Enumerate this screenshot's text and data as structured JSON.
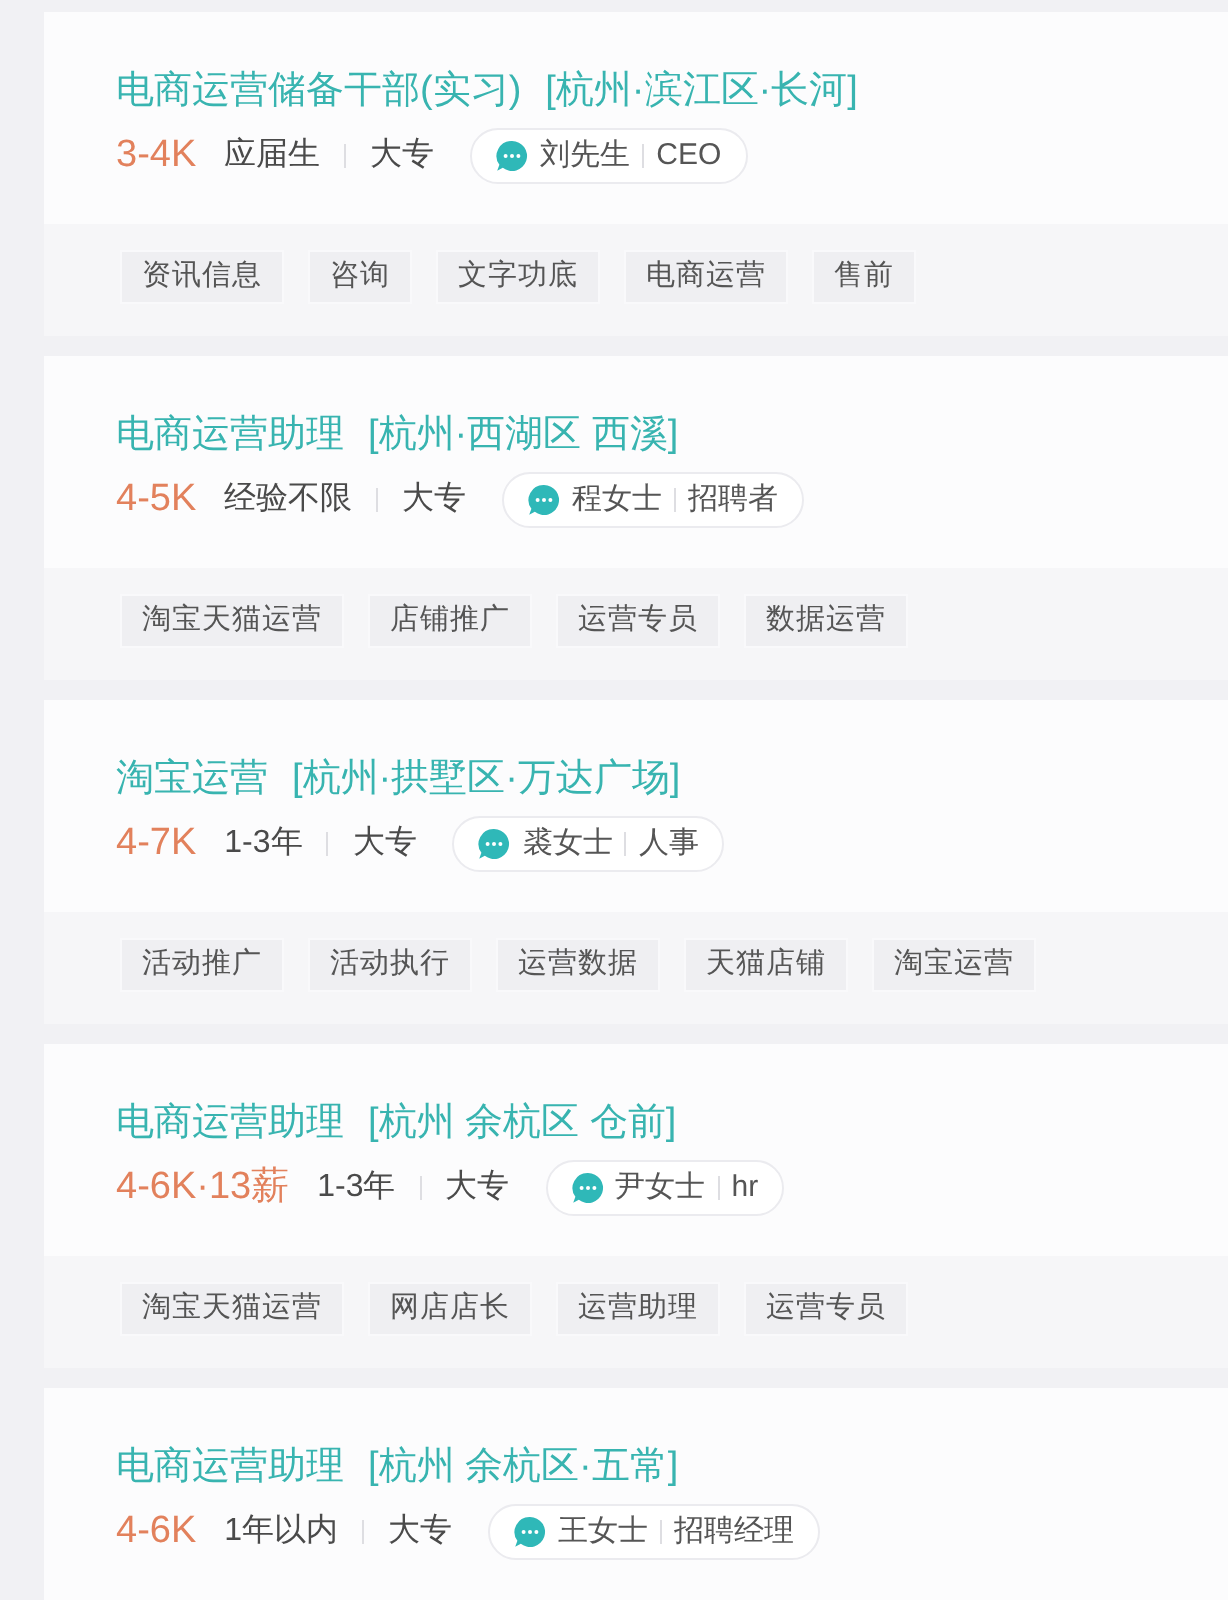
{
  "jobs": [
    {
      "title": "电商运营储备干部(实习)",
      "location": "[杭州·滨江区·长河]",
      "salary": "3-4K",
      "experience": "应届生",
      "education": "大专",
      "recruiter": {
        "name": "刘先生",
        "role": "CEO"
      },
      "tags": [
        "资讯信息",
        "咨询",
        "文字功底",
        "电商运营",
        "售前"
      ]
    },
    {
      "title": "电商运营助理",
      "location": "[杭州·西湖区 西溪]",
      "salary": "4-5K",
      "experience": "经验不限",
      "education": "大专",
      "recruiter": {
        "name": "程女士",
        "role": "招聘者"
      },
      "tags": [
        "淘宝天猫运营",
        "店铺推广",
        "运营专员",
        "数据运营"
      ]
    },
    {
      "title": "淘宝运营",
      "location": "[杭州·拱墅区·万达广场]",
      "salary": "4-7K",
      "experience": "1-3年",
      "education": "大专",
      "recruiter": {
        "name": "裘女士",
        "role": "人事"
      },
      "tags": [
        "活动推广",
        "活动执行",
        "运营数据",
        "天猫店铺",
        "淘宝运营"
      ]
    },
    {
      "title": "电商运营助理",
      "location": "[杭州 余杭区 仓前]",
      "salary": "4-6K·13薪",
      "experience": "1-3年",
      "education": "大专",
      "recruiter": {
        "name": "尹女士",
        "role": "hr"
      },
      "tags": [
        "淘宝天猫运营",
        "网店店长",
        "运营助理",
        "运营专员"
      ]
    },
    {
      "title": "电商运营助理",
      "location": "[杭州 余杭区·五常]",
      "salary": "4-6K",
      "experience": "1年以内",
      "education": "大专",
      "recruiter": {
        "name": "王女士",
        "role": "招聘经理"
      }
    }
  ]
}
